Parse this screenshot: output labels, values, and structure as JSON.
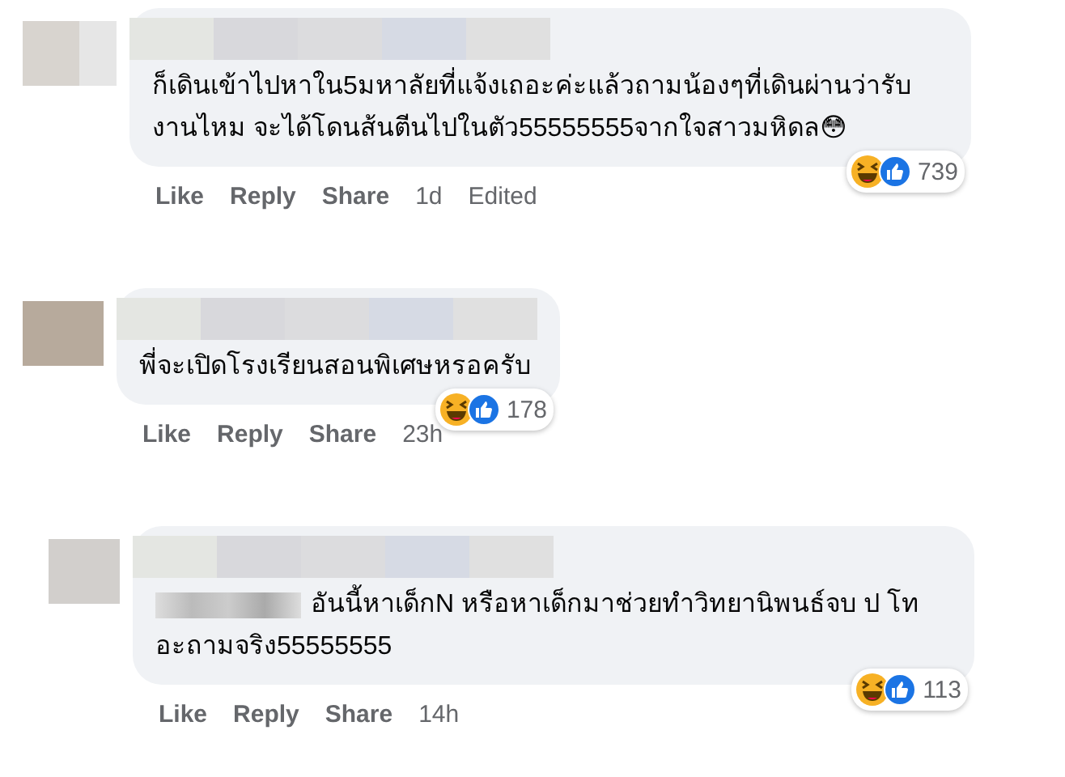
{
  "comments": [
    {
      "mention": false,
      "text": "ก็เดินเข้าไปหาใน5มหาลัยที่แจ้งเถอะค่ะแล้วถามน้องๆที่เดินผ่านว่ารับงานไหม จะได้โดนส้นตีนไปในตัว55555555จากใจสาวมหิดล😳",
      "reaction_count": "739",
      "actions": [
        "Like",
        "Reply",
        "Share"
      ],
      "time": "1d",
      "edited": "Edited"
    },
    {
      "mention": false,
      "text": "พี่จะเปิดโรงเรียนสอนพิเศษหรอครับ",
      "reaction_count": "178",
      "actions": [
        "Like",
        "Reply",
        "Share"
      ],
      "time": "23h"
    },
    {
      "mention": true,
      "text": "อันนี้หาเด็กN หรือหาเด็กมาช่วยทำวิทยานิพนธ์จบ ป โท อะถามจริง55555555",
      "reaction_count": "113",
      "actions": [
        "Like",
        "Reply",
        "Share"
      ],
      "time": "14h"
    }
  ]
}
